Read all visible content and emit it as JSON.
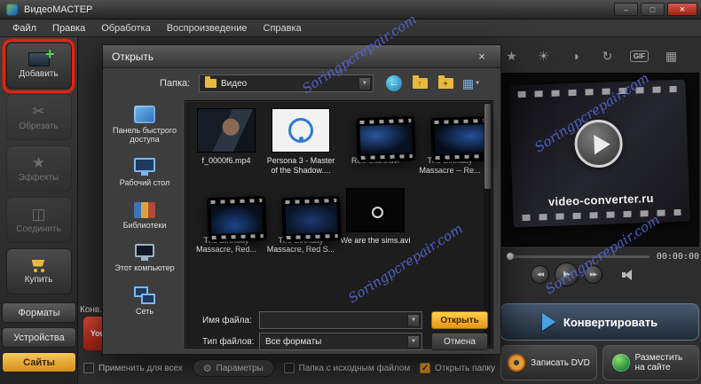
{
  "titlebar": {
    "title": "ВидеоМАСТЕР"
  },
  "glyphs": {
    "minimize": "–",
    "maximize": "□",
    "close": "×",
    "dropdown": "▼",
    "check": "✓",
    "scissors": "✂",
    "star": "★",
    "join": "◫",
    "plus": "+",
    "back": "←",
    "up": "↑",
    "grid": "▦",
    "gear": "⚙"
  },
  "menu": {
    "items": [
      {
        "label": "Файл"
      },
      {
        "label": "Правка"
      },
      {
        "label": "Обработка"
      },
      {
        "label": "Воспроизведение"
      },
      {
        "label": "Справка"
      }
    ]
  },
  "sidebar": {
    "buttons": [
      {
        "label": "Добавить"
      },
      {
        "label": "Обрезать"
      },
      {
        "label": "Эффекты"
      },
      {
        "label": "Соединить"
      },
      {
        "label": "Купить"
      }
    ],
    "tabs": [
      {
        "label": "Форматы"
      },
      {
        "label": "Устройства"
      },
      {
        "label": "Сайты"
      }
    ]
  },
  "toolbar": {
    "icons": [
      {
        "name": "enhance",
        "glyph": "★"
      },
      {
        "name": "brightness",
        "glyph": "☀"
      },
      {
        "name": "contrast",
        "glyph": "◑"
      },
      {
        "name": "rotate",
        "glyph": "↻"
      },
      {
        "name": "gif",
        "glyph": "GIF"
      },
      {
        "name": "frames",
        "glyph": "▦"
      }
    ]
  },
  "background": {
    "truncated_label": "Конв...",
    "youtube_text": "You"
  },
  "preview": {
    "brand_text": "video-converter.ru",
    "time": "00:00:00"
  },
  "playback": {
    "prev": "◀◀",
    "play": "▶",
    "next": "▶▶"
  },
  "actions": {
    "convert": "Конвертировать",
    "record_dvd": "Записать DVD",
    "publish": "Разместить на сайте"
  },
  "bottom_bar": {
    "apply_all": "Применить для всех",
    "parameters": "Параметры",
    "source_folder": "Папка с исходным файлом",
    "open_folder": "Открыть папку"
  },
  "dialog": {
    "title": "Открыть",
    "close": "×",
    "folder_label": "Папка:",
    "folder_value": "Видео",
    "places": [
      {
        "label": "Панель быстрого доступа"
      },
      {
        "label": "Рабочий стол"
      },
      {
        "label": "Библиотеки"
      },
      {
        "label": "Этот компьютер"
      },
      {
        "label": "Сеть"
      }
    ],
    "files": [
      {
        "name": "f_0000f6.mp4",
        "kind": "photo"
      },
      {
        "name": "Persona 3 - Master of the Shadow....",
        "kind": "disc"
      },
      {
        "name": "Red Stars.avi",
        "kind": "film"
      },
      {
        "name": "The Birthday Massacre -- Re...",
        "kind": "film"
      },
      {
        "name": "The Birthday Massacre, Red...",
        "kind": "film"
      },
      {
        "name": "The Birthday Massacre, Red S...",
        "kind": "film"
      },
      {
        "name": "We are the sims.avi",
        "kind": "logo"
      }
    ],
    "filename_label": "Имя файла:",
    "filename_value": "",
    "filetype_label": "Тип файлов:",
    "filetype_value": "Все форматы",
    "open_button": "Открыть",
    "cancel_button": "Отмена"
  },
  "watermark": {
    "text": "Soringpcrepair.com"
  },
  "colors": {
    "accent_orange": "#efa32a",
    "highlight_red": "#e52210",
    "watermark_blue": "#5468d2",
    "convert_blue": "#4aa3e8"
  }
}
